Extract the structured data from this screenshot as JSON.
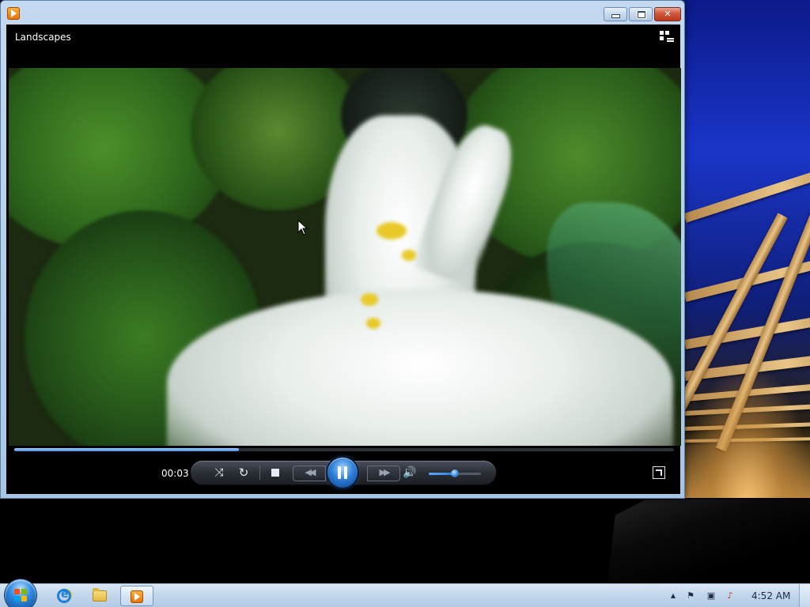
{
  "window": {
    "title": "Landscapes",
    "minimize_glyph": "",
    "maximize_glyph": "",
    "close_glyph": "✕"
  },
  "player": {
    "elapsed_time": "00:03",
    "progress_fraction": 0.34,
    "volume_fraction": 0.5,
    "shuffle_glyph": "⤨",
    "repeat_glyph": "↻",
    "prev_glyph": "◀◀",
    "next_glyph": "▶▶",
    "volume_glyph": "🔊"
  },
  "taskbar": {
    "clock": "4:52 AM",
    "tray_expand_glyph": "▲",
    "tray_flag_glyph": "⚑",
    "tray_network_glyph": "▣",
    "tray_sound_glyph": "♪"
  },
  "icons": {
    "app": "media-player-icon",
    "switch_view": "switch-to-library-icon",
    "start": "windows-start-orb",
    "browser": "internet-explorer-icon",
    "explorer": "folder-icon",
    "media_player": "media-player-icon"
  },
  "colors": {
    "accent": "#2f7fd8",
    "close_red": "#c0391b",
    "seek_fill": "#3f8ee0"
  }
}
